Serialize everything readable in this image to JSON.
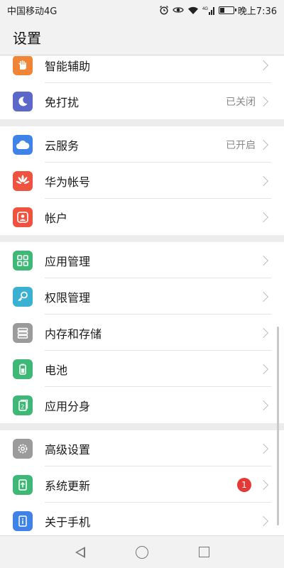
{
  "status_bar": {
    "carrier": "中国移动4G",
    "net": "4G",
    "time": "晚上7:36"
  },
  "header": {
    "title": "设置"
  },
  "groups": [
    [
      {
        "label": "智能辅助",
        "icon": "hand-icon",
        "color": "#f08537"
      },
      {
        "label": "免打扰",
        "status": "已关闭",
        "icon": "moon-icon",
        "color": "#5b67c9"
      }
    ],
    [
      {
        "label": "云服务",
        "status": "已开启",
        "icon": "cloud-icon",
        "color": "#3f82e8"
      },
      {
        "label": "华为帐号",
        "icon": "huawei-logo-icon",
        "color": "#ef5340"
      },
      {
        "label": "帐户",
        "icon": "account-icon",
        "color": "#ef5340"
      }
    ],
    [
      {
        "label": "应用管理",
        "icon": "apps-grid-icon",
        "color": "#3fb877"
      },
      {
        "label": "权限管理",
        "icon": "key-icon",
        "color": "#3ab1d3"
      },
      {
        "label": "内存和存储",
        "icon": "storage-icon",
        "color": "#9b9b9b"
      },
      {
        "label": "电池",
        "icon": "battery-icon",
        "color": "#3fb877"
      },
      {
        "label": "应用分身",
        "icon": "app-twin-icon",
        "color": "#3fb877"
      }
    ],
    [
      {
        "label": "高级设置",
        "icon": "gear-icon",
        "color": "#9b9b9b"
      },
      {
        "label": "系统更新",
        "badge": "1",
        "icon": "system-update-icon",
        "color": "#3fb877"
      },
      {
        "label": "关于手机",
        "icon": "info-icon",
        "color": "#3f82e8"
      }
    ]
  ]
}
